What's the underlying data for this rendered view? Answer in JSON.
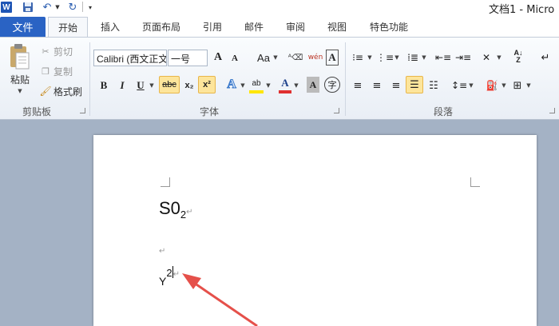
{
  "titlebar": {
    "app_icon": "W",
    "doc_title": "文档1 - Micro"
  },
  "tabs": [
    {
      "label": "文件"
    },
    {
      "label": "开始"
    },
    {
      "label": "插入"
    },
    {
      "label": "页面布局"
    },
    {
      "label": "引用"
    },
    {
      "label": "邮件"
    },
    {
      "label": "审阅"
    },
    {
      "label": "视图"
    },
    {
      "label": "特色功能"
    }
  ],
  "clipboard": {
    "paste_label": "粘贴",
    "cut_label": "剪切",
    "copy_label": "复制",
    "format_painter_label": "格式刷",
    "group_label": "剪贴板"
  },
  "font": {
    "font_name": "Calibri (西文正文)",
    "font_size": "一号",
    "group_label": "字体",
    "bold": "B",
    "italic": "I",
    "underline": "U",
    "strike": "abc",
    "subscript": "x₂",
    "superscript": "x²",
    "change_case": "Aa",
    "grow": "A",
    "shrink": "A",
    "pinyin": "wén",
    "font_color": "A",
    "char_shade": "A",
    "highlight": "ab",
    "phonetic_guide": "字"
  },
  "paragraph": {
    "group_label": "段落"
  },
  "document": {
    "line1_base": "S0",
    "line1_sub": "2",
    "line3_base": "Y",
    "line3_sup": "2",
    "para_mark": "↵"
  },
  "colors": {
    "file_tab": "#2a63c4",
    "workspace": "#a4b2c5",
    "arrow": "#e5504a",
    "highlight": "#fde59b"
  }
}
